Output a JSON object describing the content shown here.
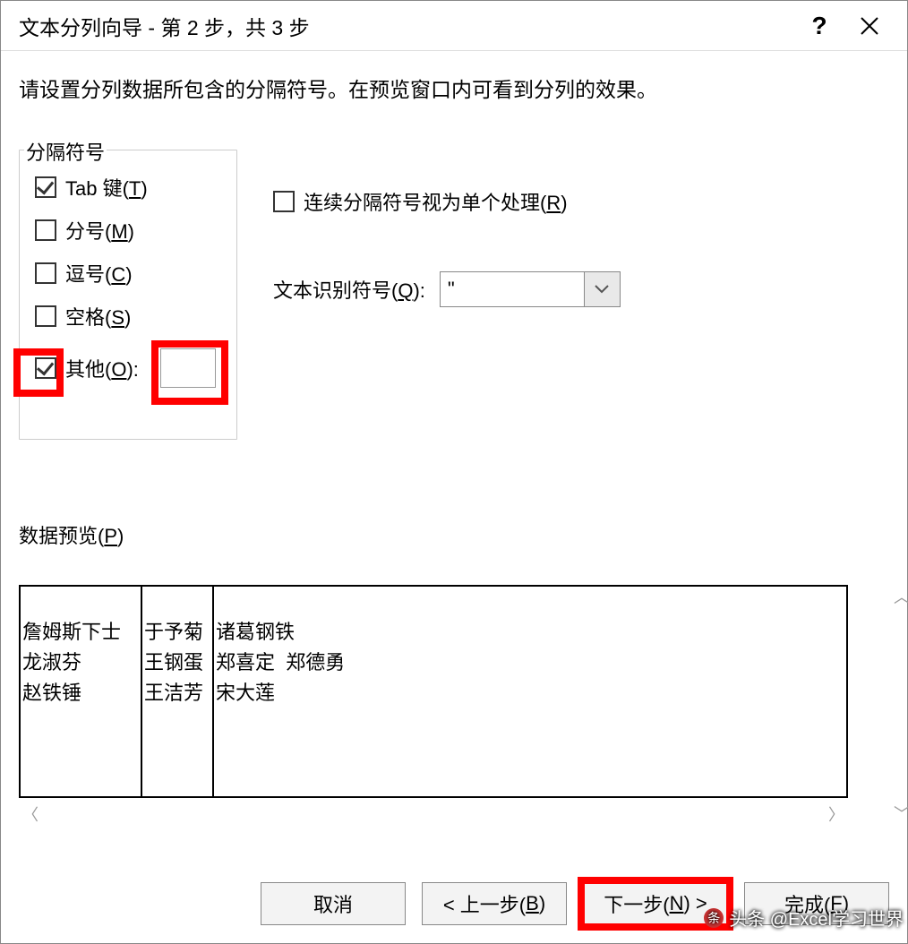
{
  "title": "文本分列向导 - 第 2 步，共 3 步",
  "description": "请设置分列数据所包含的分隔符号。在预览窗口内可看到分列的效果。",
  "group_delimiters_label": "分隔符号",
  "delimiters": {
    "tab": {
      "label_pre": "Tab 键(",
      "hotkey": "T",
      "label_post": ")",
      "checked": true
    },
    "semi": {
      "label_pre": "分号(",
      "hotkey": "M",
      "label_post": ")",
      "checked": false
    },
    "comma": {
      "label_pre": "逗号(",
      "hotkey": "C",
      "label_post": ")",
      "checked": false
    },
    "space": {
      "label_pre": "空格(",
      "hotkey": "S",
      "label_post": ")",
      "checked": false
    },
    "other": {
      "label_pre": "其他(",
      "hotkey": "O",
      "label_post": "):",
      "checked": true,
      "value": ""
    }
  },
  "treat_consecutive": {
    "label_pre": "连续分隔符号视为单个处理(",
    "hotkey": "R",
    "label_post": ")",
    "checked": false
  },
  "text_qualifier": {
    "label_pre": "文本识别符号(",
    "hotkey": "Q",
    "label_post": "):",
    "value": "\""
  },
  "preview_label_pre": "数据预览(",
  "preview_hotkey": "P",
  "preview_label_post": ")",
  "preview": {
    "columns": [
      [
        "詹姆斯下士",
        "龙淑芬",
        "赵铁锤"
      ],
      [
        "于予菊",
        "王钢蛋",
        "王洁芳"
      ],
      [
        "诸葛钢铁",
        "郑喜定  郑德勇",
        "宋大莲"
      ]
    ]
  },
  "buttons": {
    "cancel": "取消",
    "back_pre": "< 上一步(",
    "back_hot": "B",
    "back_post": ")",
    "next_pre": "下一步(",
    "next_hot": "N",
    "next_post": ") >",
    "finish_pre": "完成(",
    "finish_hot": "F",
    "finish_post": ")"
  },
  "watermark": "头条 @Excel学习世界"
}
